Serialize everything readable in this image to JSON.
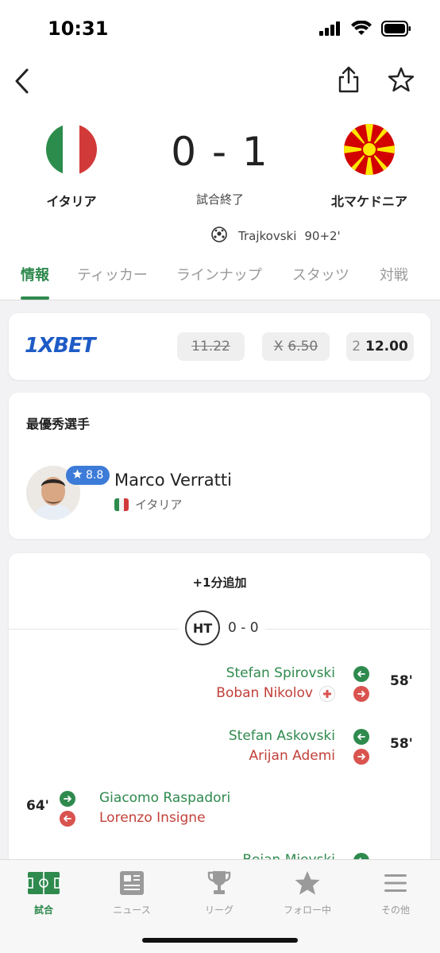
{
  "status_bar": {
    "time": "10:31"
  },
  "match": {
    "home_team": "イタリア",
    "away_team": "北マケドニア",
    "score": "0 - 1",
    "status": "試合終了",
    "goal": {
      "scorer": "Trajkovski",
      "minute": "90+2'"
    }
  },
  "tabs": [
    "情報",
    "ティッカー",
    "ラインナップ",
    "スタッツ",
    "対戦"
  ],
  "odds": {
    "brand": "1XBET",
    "items": [
      {
        "label": "1",
        "value": "1.22",
        "struck": true
      },
      {
        "label": "X",
        "value": "6.50",
        "struck": true
      },
      {
        "label": "2",
        "value": "12.00",
        "struck": false
      }
    ]
  },
  "potm": {
    "title": "最優秀選手",
    "rating": "8.8",
    "player": "Marco Verratti",
    "team": "イタリア"
  },
  "events": {
    "added_time": "+1分追加",
    "ht_label": "HT",
    "ht_score": "0 - 0",
    "subs": [
      {
        "side": "away",
        "minute": "58'",
        "in": "Stefan Spirovski",
        "out": "Boban Nikolov",
        "injury": true
      },
      {
        "side": "away",
        "minute": "58'",
        "in": "Stefan Askovski",
        "out": "Arijan Ademi",
        "injury": false
      },
      {
        "side": "home",
        "minute": "64'",
        "in": "Giacomo Raspadori",
        "out": "Lorenzo Insigne",
        "injury": false
      },
      {
        "side": "away",
        "minute": "",
        "in": "Bojan Miovski",
        "out": "",
        "injury": false
      }
    ]
  },
  "bottom_nav": [
    {
      "label": "試合",
      "icon": "pitch-icon",
      "active": true
    },
    {
      "label": "ニュース",
      "icon": "newspaper-icon",
      "active": false
    },
    {
      "label": "リーグ",
      "icon": "trophy-icon",
      "active": false
    },
    {
      "label": "フォロー中",
      "icon": "star-icon",
      "active": false
    },
    {
      "label": "その他",
      "icon": "menu-icon",
      "active": false
    }
  ],
  "colors": {
    "accent_green": "#2f8a4e",
    "sub_out_red": "#c2403a",
    "rating_blue": "#3c7bd8",
    "brand_blue": "#1e5bc6"
  }
}
